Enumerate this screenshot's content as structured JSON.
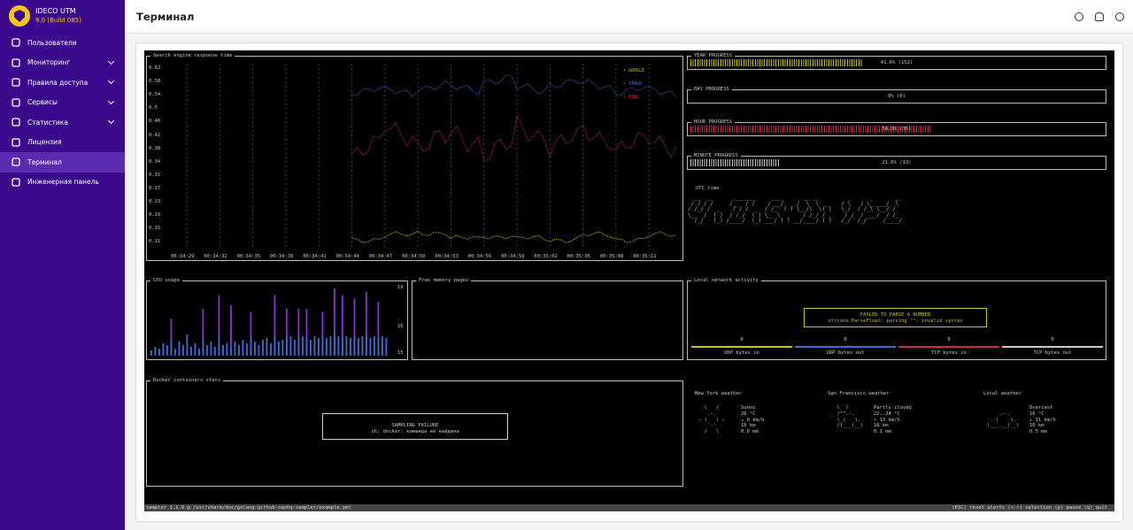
{
  "app": {
    "name": "IDECO UTM",
    "version": "9.0 (Build 085)"
  },
  "nav": [
    {
      "label": "Пользователи",
      "icon": "users-icon",
      "chevron": false
    },
    {
      "label": "Мониторинг",
      "icon": "chart-line-icon",
      "chevron": true
    },
    {
      "label": "Правила доступа",
      "icon": "shield-icon",
      "chevron": true
    },
    {
      "label": "Сервисы",
      "icon": "sliders-icon",
      "chevron": true
    },
    {
      "label": "Статистика",
      "icon": "stats-file-icon",
      "chevron": true
    },
    {
      "label": "Лицензия",
      "icon": "license-icon",
      "chevron": false
    },
    {
      "label": "Терминал",
      "icon": "terminal-icon",
      "chevron": false,
      "active": true
    },
    {
      "label": "Инженерная панель",
      "icon": "gears-icon",
      "chevron": false
    }
  ],
  "page_title": "Терминал",
  "header_icons": [
    "theme-icon",
    "bell-icon",
    "user-icon"
  ],
  "colors": {
    "sidebar": "#3b0a8c",
    "accent": "#f5c518",
    "google": "#c8c800",
    "yahoo": "#3a6fd6",
    "bing": "#d0284e",
    "purple": "#8f2fd9",
    "blue": "#3a6fd6",
    "pink": "#d0284e",
    "white": "#cccccc"
  },
  "response": {
    "title": "Search engine response time",
    "yticks": [
      "0.62",
      "0.58",
      "0.54",
      "0.5",
      "0.46",
      "0.42",
      "0.38",
      "0.34",
      "0.31",
      "0.27",
      "0.23",
      "0.19",
      "0.15",
      "0.11"
    ],
    "xticks": [
      "00:34:29",
      "00:34:32",
      "00:34:35",
      "00:34:38",
      "00:34:41",
      "00:34:44",
      "00:34:47",
      "00:34:50",
      "00:34:53",
      "00:34:56",
      "00:34:59",
      "00:35:02",
      "00:35:05",
      "00:35:08",
      "00:35:11"
    ],
    "legend": [
      "GOOGLE",
      "YAHOO",
      "BING"
    ]
  },
  "chart_data": {
    "type": "line",
    "title": "Search engine response time",
    "ylim": [
      0.11,
      0.62
    ],
    "x": [
      "00:34:29",
      "00:34:32",
      "00:34:35",
      "00:34:38",
      "00:34:41",
      "00:34:44",
      "00:34:47",
      "00:34:50",
      "00:34:53",
      "00:34:56",
      "00:34:59",
      "00:35:02",
      "00:35:05",
      "00:35:08",
      "00:35:11"
    ],
    "series": [
      {
        "name": "GOOGLE",
        "values": [
          null,
          null,
          null,
          null,
          null,
          0.12,
          0.13,
          0.14,
          0.12,
          0.13,
          0.12,
          0.12,
          0.13,
          0.12,
          0.13
        ]
      },
      {
        "name": "YAHOO",
        "values": [
          null,
          null,
          null,
          null,
          null,
          0.56,
          0.55,
          0.57,
          0.56,
          0.59,
          0.56,
          0.58,
          0.57,
          0.56,
          0.55
        ]
      },
      {
        "name": "BING",
        "values": [
          null,
          null,
          null,
          null,
          null,
          0.38,
          0.44,
          0.4,
          0.42,
          0.38,
          0.44,
          0.4,
          0.43,
          0.39,
          0.41
        ]
      }
    ]
  },
  "progress": [
    {
      "title": "YEAR PROGRESS",
      "value": "41.6% (152)",
      "fraction": 0.416,
      "color": "#c8c800"
    },
    {
      "title": "DAY PROGRESS",
      "value": "0% (0)",
      "fraction": 0,
      "color": "#cccccc"
    },
    {
      "title": "HOUR PROGRESS",
      "value": "58.3% (35)",
      "fraction": 0.583,
      "color": "#d0284e"
    },
    {
      "title": "MINUTE PROGRESS",
      "value": "21.6% (13)",
      "fraction": 0.216,
      "color": "#cccccc"
    }
  ],
  "utc": {
    "title": "UTC time"
  },
  "cpu": {
    "title": "CPU usage",
    "ticks": [
      "19",
      "16",
      "15"
    ],
    "bars": [
      [
        0.15,
        0
      ],
      [
        0.25,
        0
      ],
      [
        0.2,
        0
      ],
      [
        0.35,
        0
      ],
      [
        0.3,
        0
      ],
      [
        0.45,
        0.55
      ],
      [
        0.2,
        0
      ],
      [
        0.4,
        0
      ],
      [
        0.3,
        0
      ],
      [
        0.6,
        0
      ],
      [
        0.25,
        0
      ],
      [
        0.35,
        0
      ],
      [
        0.2,
        0
      ],
      [
        0.5,
        0.7
      ],
      [
        0.3,
        0
      ],
      [
        0.4,
        0
      ],
      [
        0.25,
        0
      ],
      [
        0.55,
        0.9
      ],
      [
        0.3,
        0
      ],
      [
        0.35,
        0
      ],
      [
        0.25,
        0.75
      ],
      [
        0.4,
        0
      ],
      [
        0.3,
        0
      ],
      [
        0.45,
        0
      ],
      [
        0.35,
        0
      ],
      [
        0.55,
        0.65
      ],
      [
        0.4,
        0
      ],
      [
        0.3,
        0
      ],
      [
        0.45,
        0
      ],
      [
        0.5,
        0
      ],
      [
        0.35,
        0
      ],
      [
        0.55,
        0.9
      ],
      [
        0.4,
        0
      ],
      [
        0.45,
        0
      ],
      [
        0.5,
        0.7
      ],
      [
        0.55,
        0
      ],
      [
        0.45,
        0
      ],
      [
        0.5,
        0.7
      ],
      [
        0.55,
        0
      ],
      [
        0.5,
        0.7
      ],
      [
        0.45,
        0
      ],
      [
        0.55,
        0
      ],
      [
        0.5,
        0
      ],
      [
        0.55,
        0.65
      ],
      [
        0.5,
        0
      ],
      [
        0.55,
        0
      ],
      [
        0.6,
        1
      ],
      [
        0.55,
        0
      ],
      [
        0.5,
        0.9
      ],
      [
        0.55,
        0
      ],
      [
        0.5,
        0
      ],
      [
        0.55,
        0.85
      ],
      [
        0.5,
        0
      ],
      [
        0.55,
        0
      ],
      [
        0.6,
        0.95
      ],
      [
        0.5,
        0
      ],
      [
        0.55,
        0
      ],
      [
        0.5,
        0.8
      ],
      [
        0.55,
        0
      ],
      [
        0.5,
        0
      ]
    ]
  },
  "memory": {
    "title": "Free memory pages"
  },
  "network": {
    "title": "Local network activity",
    "error_title": "FAILED TO PARSE A NUMBER",
    "error_msg": "strconv.ParseFloat: parsing \"\": invalid syntax",
    "gauges": [
      {
        "value": "0",
        "label": "UDP bytes in",
        "color": "#c8c800"
      },
      {
        "value": "0",
        "label": "UDP bytes out",
        "color": "#3a6fd6"
      },
      {
        "value": "0",
        "label": "TCP bytes in",
        "color": "#d0284e"
      },
      {
        "value": "0",
        "label": "TCP bytes out",
        "color": "#cccccc"
      }
    ]
  },
  "docker": {
    "title": "Docker containers stats",
    "error_title": "SAMPLING FAILURE",
    "error_msg": "sh: docker: команда не найдена"
  },
  "weather": [
    {
      "title": "New York weather",
      "art": "  \\   /   \n   .-.    \n― (   ) ― \n   `-'    \n  /   \\   ",
      "lines": "Sunny\n26 °C\n↘ 0 km/h\n16 km\n0.0 mm"
    },
    {
      "title": "San Francisco weather",
      "art": "  \\  /     \n_ /\"\".-.   \n  \\_(   ).  \n  /(___(__) ",
      "lines": "Partly cloudy\n22..24 °C\n↑ 13 km/h\n16 km\n0.1 mm"
    },
    {
      "title": "Local weather",
      "art": "           \n    .--.   \n .-(    ). \n(___.__)__)",
      "lines": "Overcast\n16 °C\n↓ 31 km/h\n10 km\n0.5 mm"
    }
  ],
  "statusbar": {
    "left": "sampler 1.1.0 @ /usr/share/doc/golang-github-sqshq-sampler/example.yml",
    "right": "(ESC) reset alerts  (<->) selection  (p) pause  (q) quit"
  }
}
